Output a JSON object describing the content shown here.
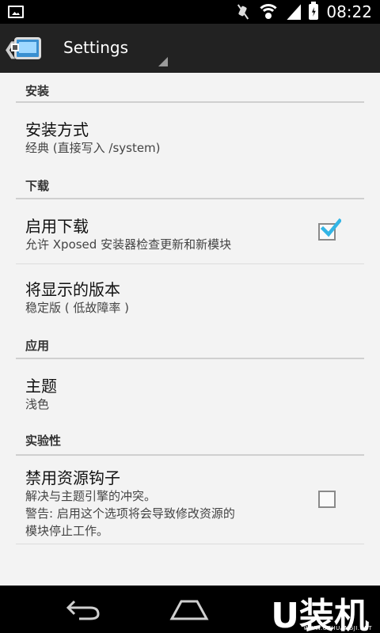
{
  "status_bar": {
    "time": "08:22",
    "icons": [
      "picture-icon",
      "mute-icon",
      "wifi-icon",
      "signal-icon",
      "battery-icon"
    ]
  },
  "action_bar": {
    "title": "Settings",
    "up_caret": "❮"
  },
  "settings": {
    "categories": [
      {
        "label": "安装"
      },
      {
        "label": "下载"
      },
      {
        "label": "应用"
      },
      {
        "label": "实验性"
      }
    ],
    "install_method": {
      "title": "安装方式",
      "summary": "经典 (直接写入 /system)"
    },
    "enable_download": {
      "title": "启用下载",
      "summary": "允许 Xposed 安装器检查更新和新模块",
      "checked": true
    },
    "version_to_show": {
      "title": "将显示的版本",
      "summary": "稳定版 ( 低故障率 )"
    },
    "theme": {
      "title": "主题",
      "summary": "浅色"
    },
    "disable_resource_hooks": {
      "title": "禁用资源钩子",
      "summary_lines": [
        "解决与主题引擎的冲突。",
        "警告: 启用这个选项将会导致修改资源的",
        "模块停止工作。"
      ],
      "checked": false
    }
  },
  "colors": {
    "check_blue": "#33b5e5",
    "background": "#f3f3f3",
    "action_bar": "#222222"
  },
  "watermark": {
    "text": "U装机",
    "url": "WWW.UZHUANGJI.NET"
  }
}
